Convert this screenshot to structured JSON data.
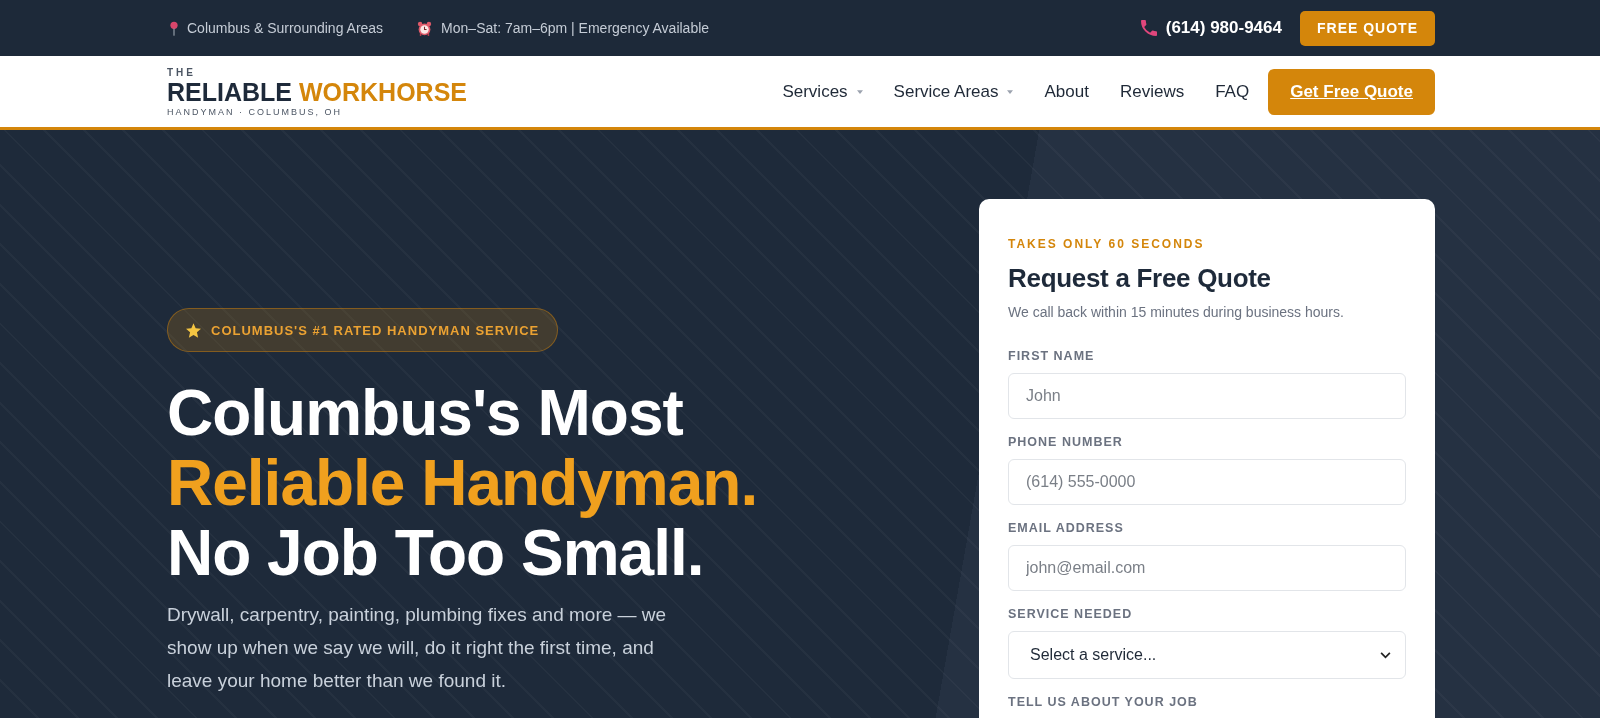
{
  "top_bar": {
    "location": "Columbus & Surrounding Areas",
    "hours": "Mon–Sat: 7am–6pm | Emergency Available",
    "phone": "(614) 980-9464",
    "quote_button": "FREE QUOTE"
  },
  "navbar": {
    "logo": {
      "prefix": "THE",
      "words": [
        {
          "text": "RELIABLE",
          "accent": false
        },
        {
          "text": "WORKHORSE",
          "accent": true
        }
      ],
      "tagline": "HANDYMAN · COLUMBUS, OH"
    },
    "links": [
      {
        "label": "Services",
        "has_dropdown": true
      },
      {
        "label": "Service Areas",
        "has_dropdown": true
      },
      {
        "label": "About",
        "has_dropdown": false
      },
      {
        "label": "Reviews",
        "has_dropdown": false
      },
      {
        "label": "FAQ",
        "has_dropdown": false
      }
    ],
    "cta_button": "Get Free Quote"
  },
  "hero": {
    "badge": "COLUMBUS'S #1 RATED HANDYMAN SERVICE",
    "heading_lines": [
      {
        "text": "Columbus's Most",
        "accent": false
      },
      {
        "text": "Reliable Handyman.",
        "accent": true
      },
      {
        "text": "No Job Too Small.",
        "accent": false
      }
    ],
    "description": "Drywall, carpentry, painting, plumbing fixes and more — we show up when we say we will, do it right the first time, and leave your home better than we found it."
  },
  "quote_form": {
    "eyebrow": "TAKES ONLY 60 SECONDS",
    "title": "Request a Free Quote",
    "subtitle": "We call back within 15 minutes during business hours.",
    "fields": [
      {
        "kind": "input",
        "label": "FIRST NAME",
        "placeholder": "John"
      },
      {
        "kind": "input",
        "label": "PHONE NUMBER",
        "placeholder": "(614) 555-0000"
      },
      {
        "kind": "input",
        "label": "EMAIL ADDRESS",
        "placeholder": "john@email.com"
      },
      {
        "kind": "select",
        "label": "SERVICE NEEDED",
        "value": "Select a service..."
      },
      {
        "kind": "textarea",
        "label": "TELL US ABOUT YOUR JOB"
      }
    ]
  }
}
